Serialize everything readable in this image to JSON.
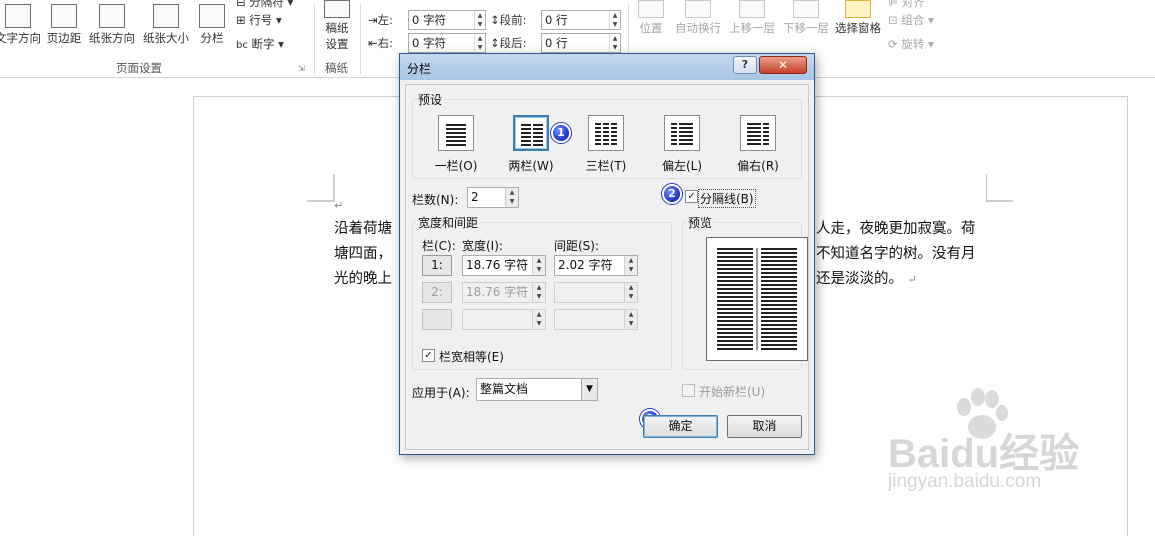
{
  "ribbon": {
    "page_setup_buttons": [
      "文字方向",
      "页边距",
      "纸张方向",
      "纸张大小",
      "分栏"
    ],
    "line_numbers": "行号",
    "hyphenation": "断字",
    "breaks_partial": "分隔符",
    "page_setup_group": "页面设置",
    "draft_button": "稿纸设置",
    "draft_button_line2": "设置",
    "draft_button_line1": "稿纸",
    "draft_group": "稿纸",
    "indent_left_label": "左:",
    "indent_left_value": "0 字符",
    "indent_right_label": "右:",
    "indent_right_value": "0 字符",
    "spacing_before_label": "段前:",
    "spacing_before_value": "0 行",
    "spacing_after_label": "段后:",
    "spacing_after_value": "0 行",
    "arrange_buttons": [
      "位置",
      "自动换行",
      "上移一层",
      "下移一层",
      "选择窗格"
    ],
    "group_label": "组合",
    "rotate_label": "旋转",
    "align_label": "对齐"
  },
  "document": {
    "lines": [
      "沿着荷塘",
      "塘四面，",
      "光的晚上"
    ],
    "lines_right": [
      "人走，夜晚更加寂寞。荷",
      "不知道名字的树。没有月",
      "还是淡淡的。"
    ]
  },
  "dialog": {
    "title": "分栏",
    "help": "?",
    "close": "✕",
    "presets_title": "预设",
    "presets": [
      {
        "label": "一栏(O)",
        "key": "O"
      },
      {
        "label": "两栏(W)",
        "key": "W"
      },
      {
        "label": "三栏(T)",
        "key": "T"
      },
      {
        "label": "偏左(L)",
        "key": "L"
      },
      {
        "label": "偏右(R)",
        "key": "R"
      }
    ],
    "selected_preset": 1,
    "num_cols_label": "栏数(N):",
    "num_cols_value": "2",
    "line_between_label": "分隔线(B)",
    "line_between_checked": true,
    "width_spacing_title": "宽度和间距",
    "col_header": "栏(C):",
    "width_header": "宽度(I):",
    "spacing_header": "间距(S):",
    "rows": [
      {
        "index": "1:",
        "width": "18.76 字符",
        "spacing": "2.02 字符",
        "enabled": true
      },
      {
        "index": "2:",
        "width": "18.76 字符",
        "spacing": "",
        "enabled": false
      },
      {
        "index": "",
        "width": "",
        "spacing": "",
        "enabled": false
      }
    ],
    "equal_width_label": "栏宽相等(E)",
    "equal_width_checked": true,
    "preview_title": "预览",
    "apply_to_label": "应用于(A):",
    "apply_to_value": "整篇文档",
    "start_new_col_label": "开始新栏(U)",
    "ok": "确定",
    "cancel": "取消"
  },
  "annotations": [
    "1",
    "2",
    "3"
  ],
  "watermark": {
    "brand": "Baidu经验",
    "url": "jingyan.baidu.com"
  },
  "colors": {
    "accent": "#3c7fb1",
    "badge": "#1e2fc7",
    "titlebar": "#a9c6e6"
  }
}
